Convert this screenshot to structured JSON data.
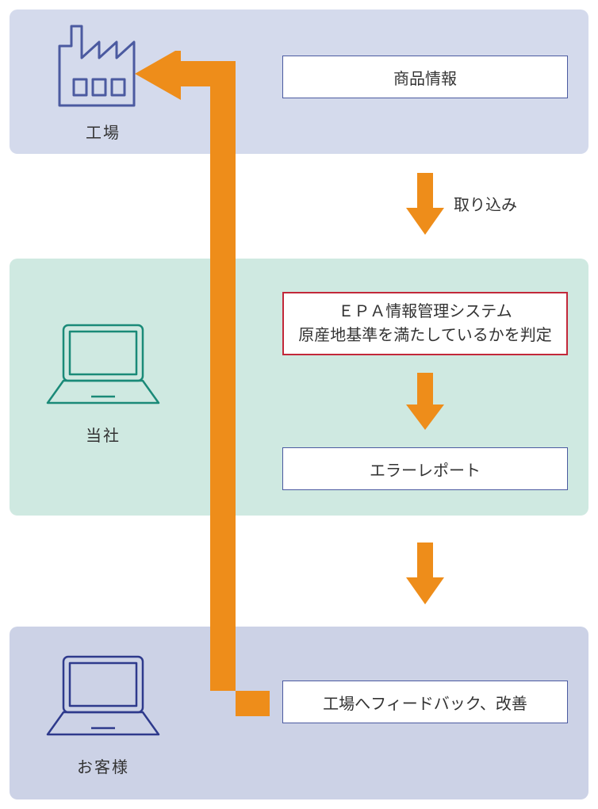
{
  "rows": {
    "factory": {
      "label": "工場"
    },
    "company": {
      "label": "当社"
    },
    "customer": {
      "label": "お客様"
    }
  },
  "boxes": {
    "product_info": "商品情報",
    "epa_line1": "ＥＰＡ情報管理システム",
    "epa_line2": "原産地基準を満たしているかを判定",
    "error_report": "エラーレポート",
    "feedback": "工場へフィードバック、改善"
  },
  "arrows": {
    "import_label": "取り込み"
  },
  "colors": {
    "arrow_fill": "#ee8d1a",
    "row1_bg": "#d4daec",
    "row2_bg": "#cfe9e1",
    "row3_bg": "#ccd2e6",
    "box_border": "#4b5aa0",
    "box_red_border": "#c2283a",
    "factory_icon": "#4b5aa0",
    "company_icon": "#1a8a78",
    "customer_icon": "#2e3a8c"
  }
}
